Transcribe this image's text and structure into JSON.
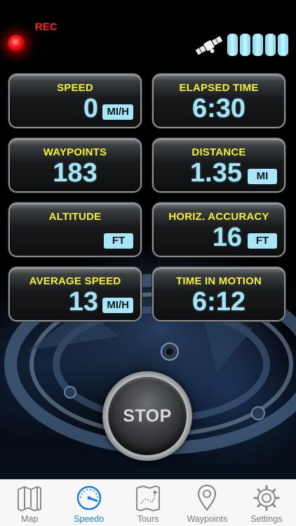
{
  "status": {
    "rec_label": "REC",
    "satellite_icon": "satellite-icon",
    "signal_bars": 5
  },
  "tiles": {
    "speed": {
      "label": "SPEED",
      "value": "0",
      "unit": "MI/H"
    },
    "elapsed_time": {
      "label": "ELAPSED TIME",
      "value": "6:30"
    },
    "waypoints": {
      "label": "WAYPOINTS",
      "value": "183"
    },
    "distance": {
      "label": "DISTANCE",
      "value": "1.35",
      "unit": "MI"
    },
    "altitude": {
      "label": "ALTITUDE",
      "value": "",
      "unit": "FT"
    },
    "horiz_accuracy": {
      "label": "HORIZ. ACCURACY",
      "value": "16",
      "unit": "FT"
    },
    "average_speed": {
      "label": "AVERAGE SPEED",
      "value": "13",
      "unit": "MI/H"
    },
    "time_in_motion": {
      "label": "TIME IN MOTION",
      "value": "6:12"
    }
  },
  "stop_button": {
    "label": "STOP"
  },
  "tabbar": {
    "items": [
      {
        "label": "Map",
        "icon": "map-icon",
        "active": false
      },
      {
        "label": "Speedo",
        "icon": "speedometer-icon",
        "active": true
      },
      {
        "label": "Tours",
        "icon": "tours-map-icon",
        "active": false
      },
      {
        "label": "Waypoints",
        "icon": "location-pin-icon",
        "active": false
      },
      {
        "label": "Settings",
        "icon": "gear-icon",
        "active": false
      }
    ]
  },
  "colors": {
    "label_yellow": "#f4f03a",
    "value_cyan": "#a5e4f5",
    "rec_red": "#ff1f1f",
    "tab_active": "#1a7fe0",
    "tab_inactive": "#7a7a7a"
  }
}
